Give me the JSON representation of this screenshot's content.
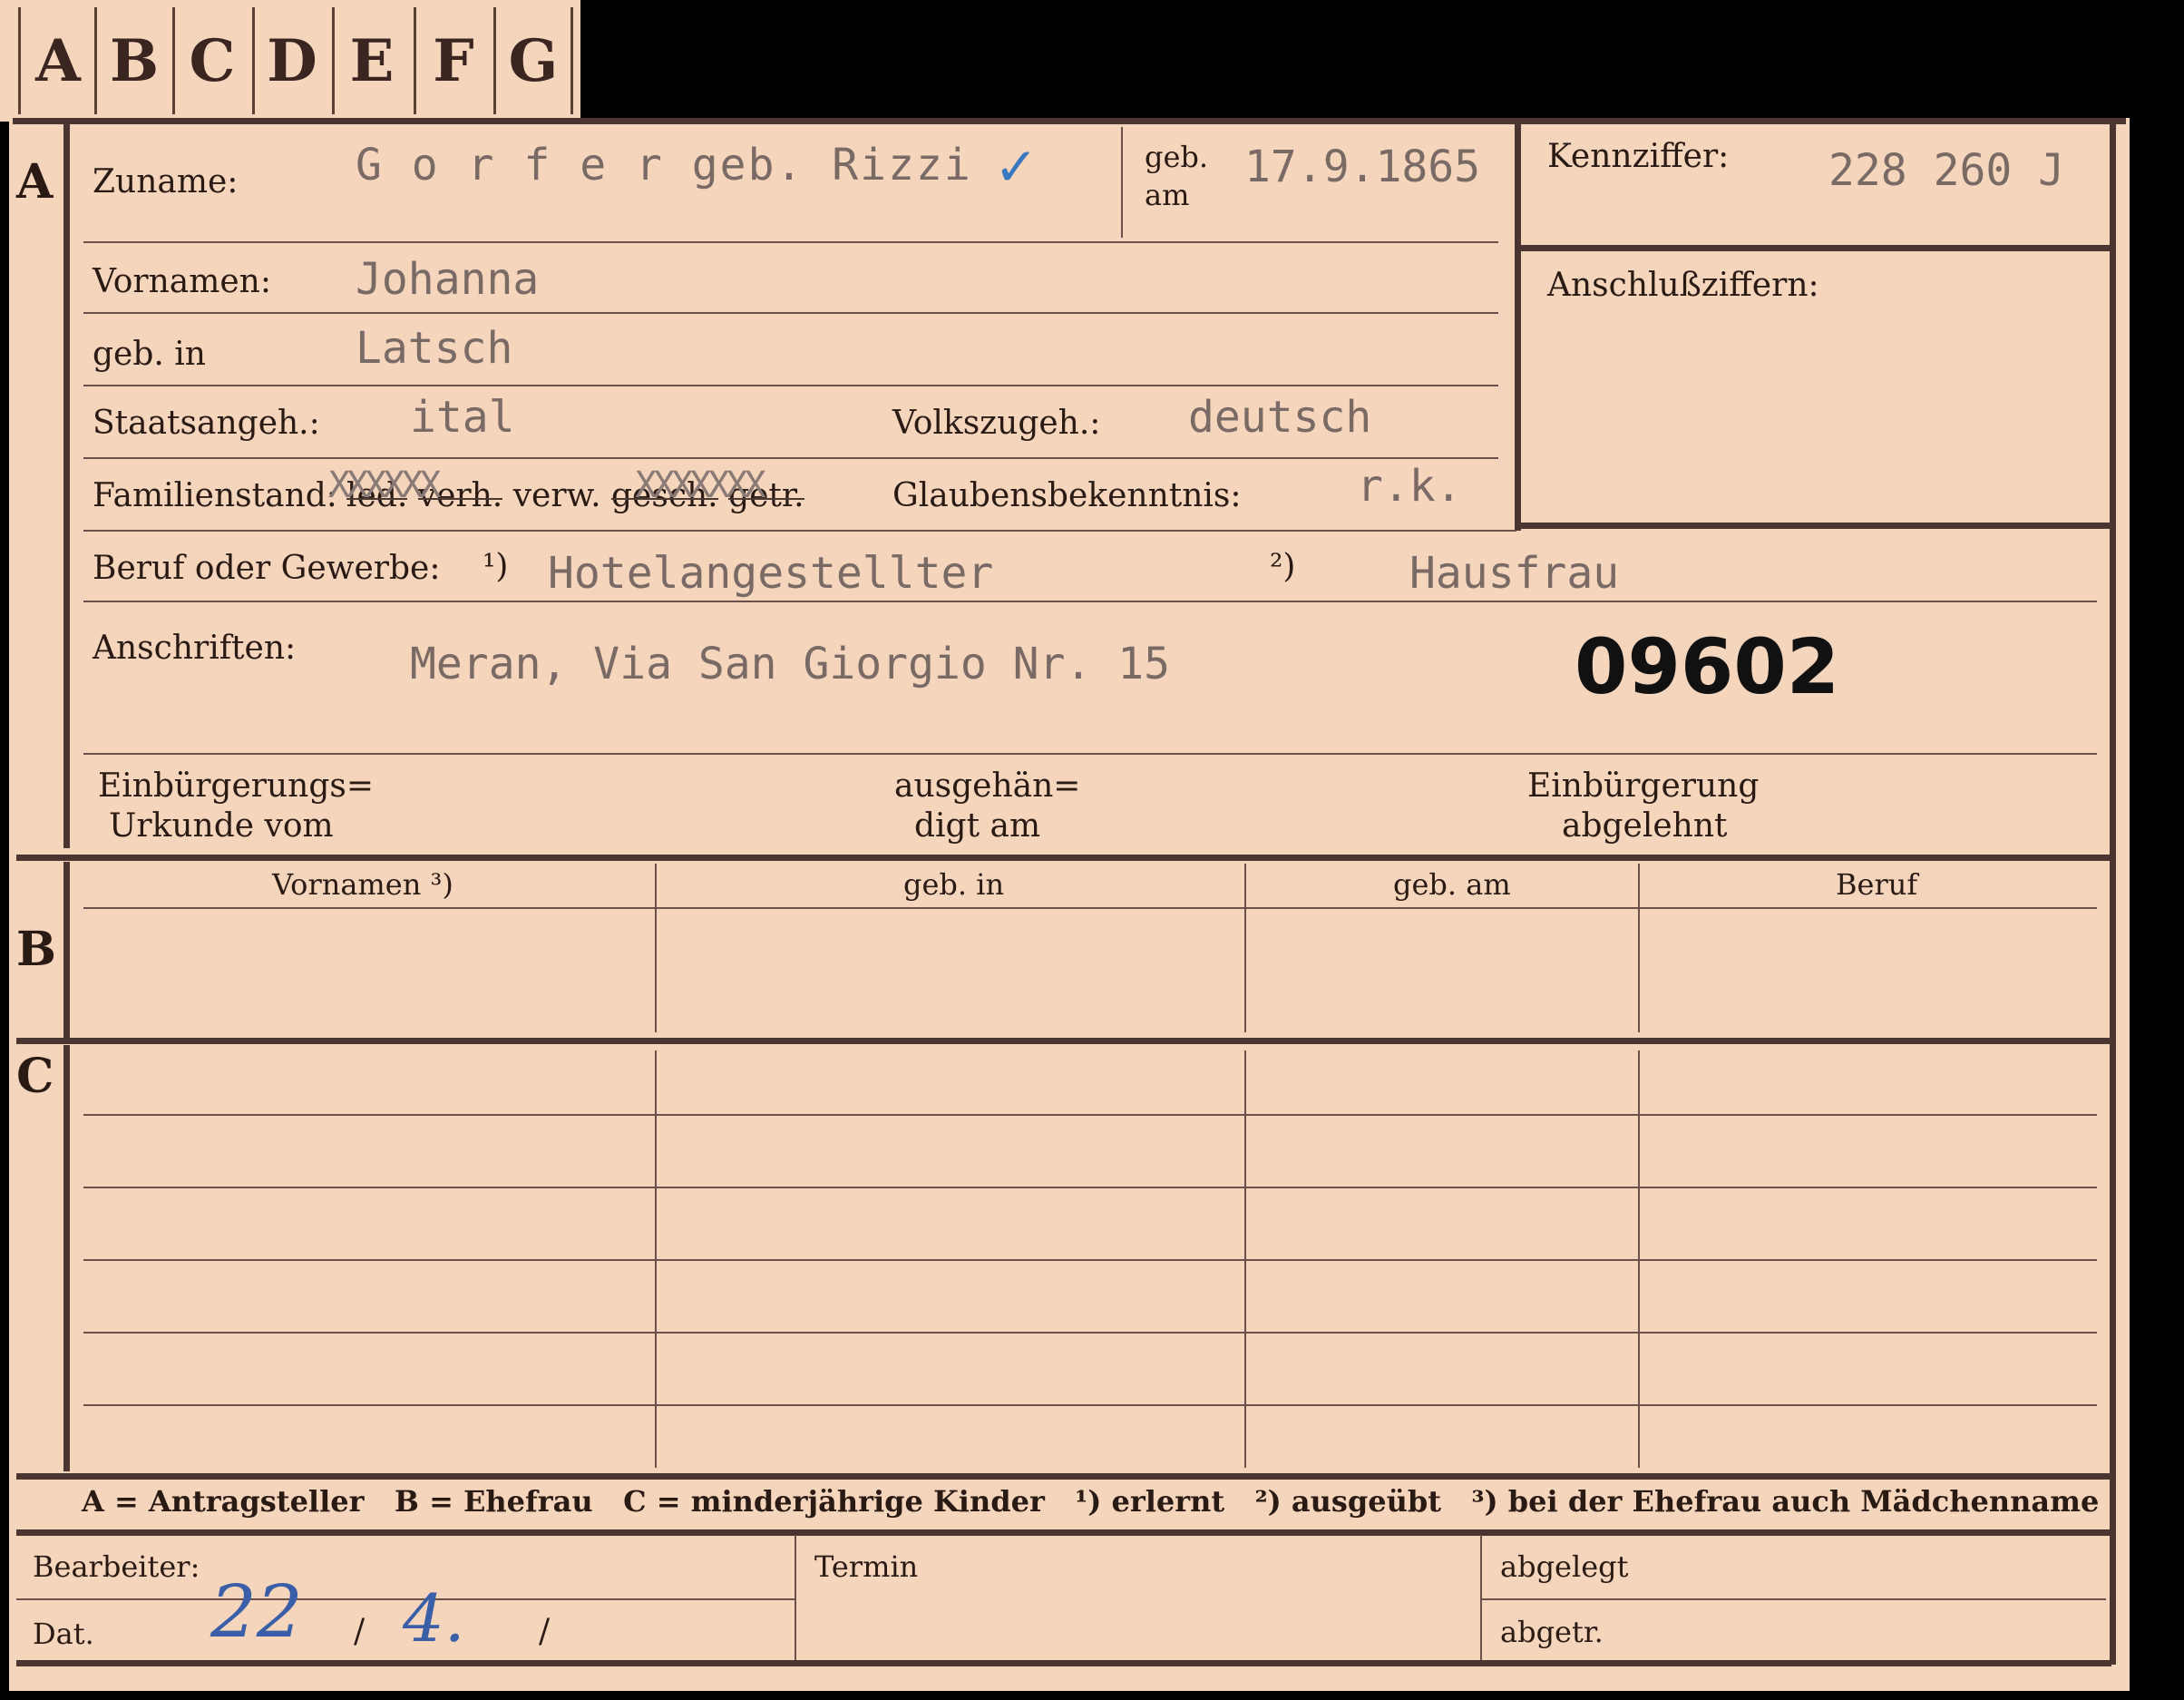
{
  "tabs": [
    "A",
    "B",
    "C",
    "D",
    "E",
    "F",
    "G"
  ],
  "sections": {
    "a": "A",
    "b": "B",
    "c": "C"
  },
  "fields": {
    "zuname_label": "Zuname:",
    "zuname_value": "G o r f e r  geb. Rizzi",
    "check_mark": "✓",
    "geb_am_label_1": "geb.",
    "geb_am_label_2": "am",
    "geb_am_value": "17.9.1865",
    "kennziffer_label": "Kennziffer:",
    "kennziffer_value": "228 260 J",
    "anschluss_label": "Anschlußziffern:",
    "vornamen_label": "Vornamen:",
    "vornamen_value": "Johanna",
    "geb_in_label": "geb. in",
    "geb_in_value": "Latsch",
    "staats_label": "Staatsangeh.:",
    "staats_value": "ital",
    "volks_label": "Volkszugeh.:",
    "volks_value": "deutsch",
    "familien_label": "Familienstand:",
    "familien_led": "led.",
    "familien_verh": "verh.",
    "familien_verw": "verw.",
    "familien_gesch": "gesch.",
    "familien_getr": "getr.",
    "x_marks_1": "XXXXXX",
    "x_marks_2": "XXXXXXX",
    "glaubens_label": "Glaubensbekenntnis:",
    "glaubens_value": "r.k.",
    "beruf_label": "Beruf oder Gewerbe:",
    "beruf_marker_1": "¹)",
    "beruf_value_1": "Hotelangestellter",
    "beruf_marker_2": "²)",
    "beruf_value_2": "Hausfrau",
    "anschriften_label": "Anschriften:",
    "anschriften_value": "Meran, Via San Giorgio  Nr. 15",
    "stamp_number": "09602",
    "einb_urkunde_1": "Einbürgerungs=",
    "einb_urkunde_2": "Urkunde vom",
    "ausgeh_1": "ausgehän=",
    "ausgeh_2": "digt am",
    "einb_abgelehnt_1": "Einbürgerung",
    "einb_abgelehnt_2": "abgelehnt"
  },
  "table": {
    "headers": [
      "Vornamen ³)",
      "geb. in",
      "geb. am",
      "Beruf"
    ]
  },
  "legend": {
    "a": "A = Antragsteller",
    "b": "B = Ehefrau",
    "c": "C = minderjährige Kinder",
    "n1": "¹) erlernt",
    "n2": "²) ausgeübt",
    "n3": "³) bei der Ehefrau auch Mädchenname"
  },
  "footer": {
    "bearbeiter_label": "Bearbeiter:",
    "termin_label": "Termin",
    "abgelegt_label": "abgelegt",
    "dat_label": "Dat.",
    "dat_day": "22",
    "dat_sep_1": "/",
    "dat_month": "4.",
    "dat_sep_2": "/",
    "abgetr_label": "abgetr."
  }
}
